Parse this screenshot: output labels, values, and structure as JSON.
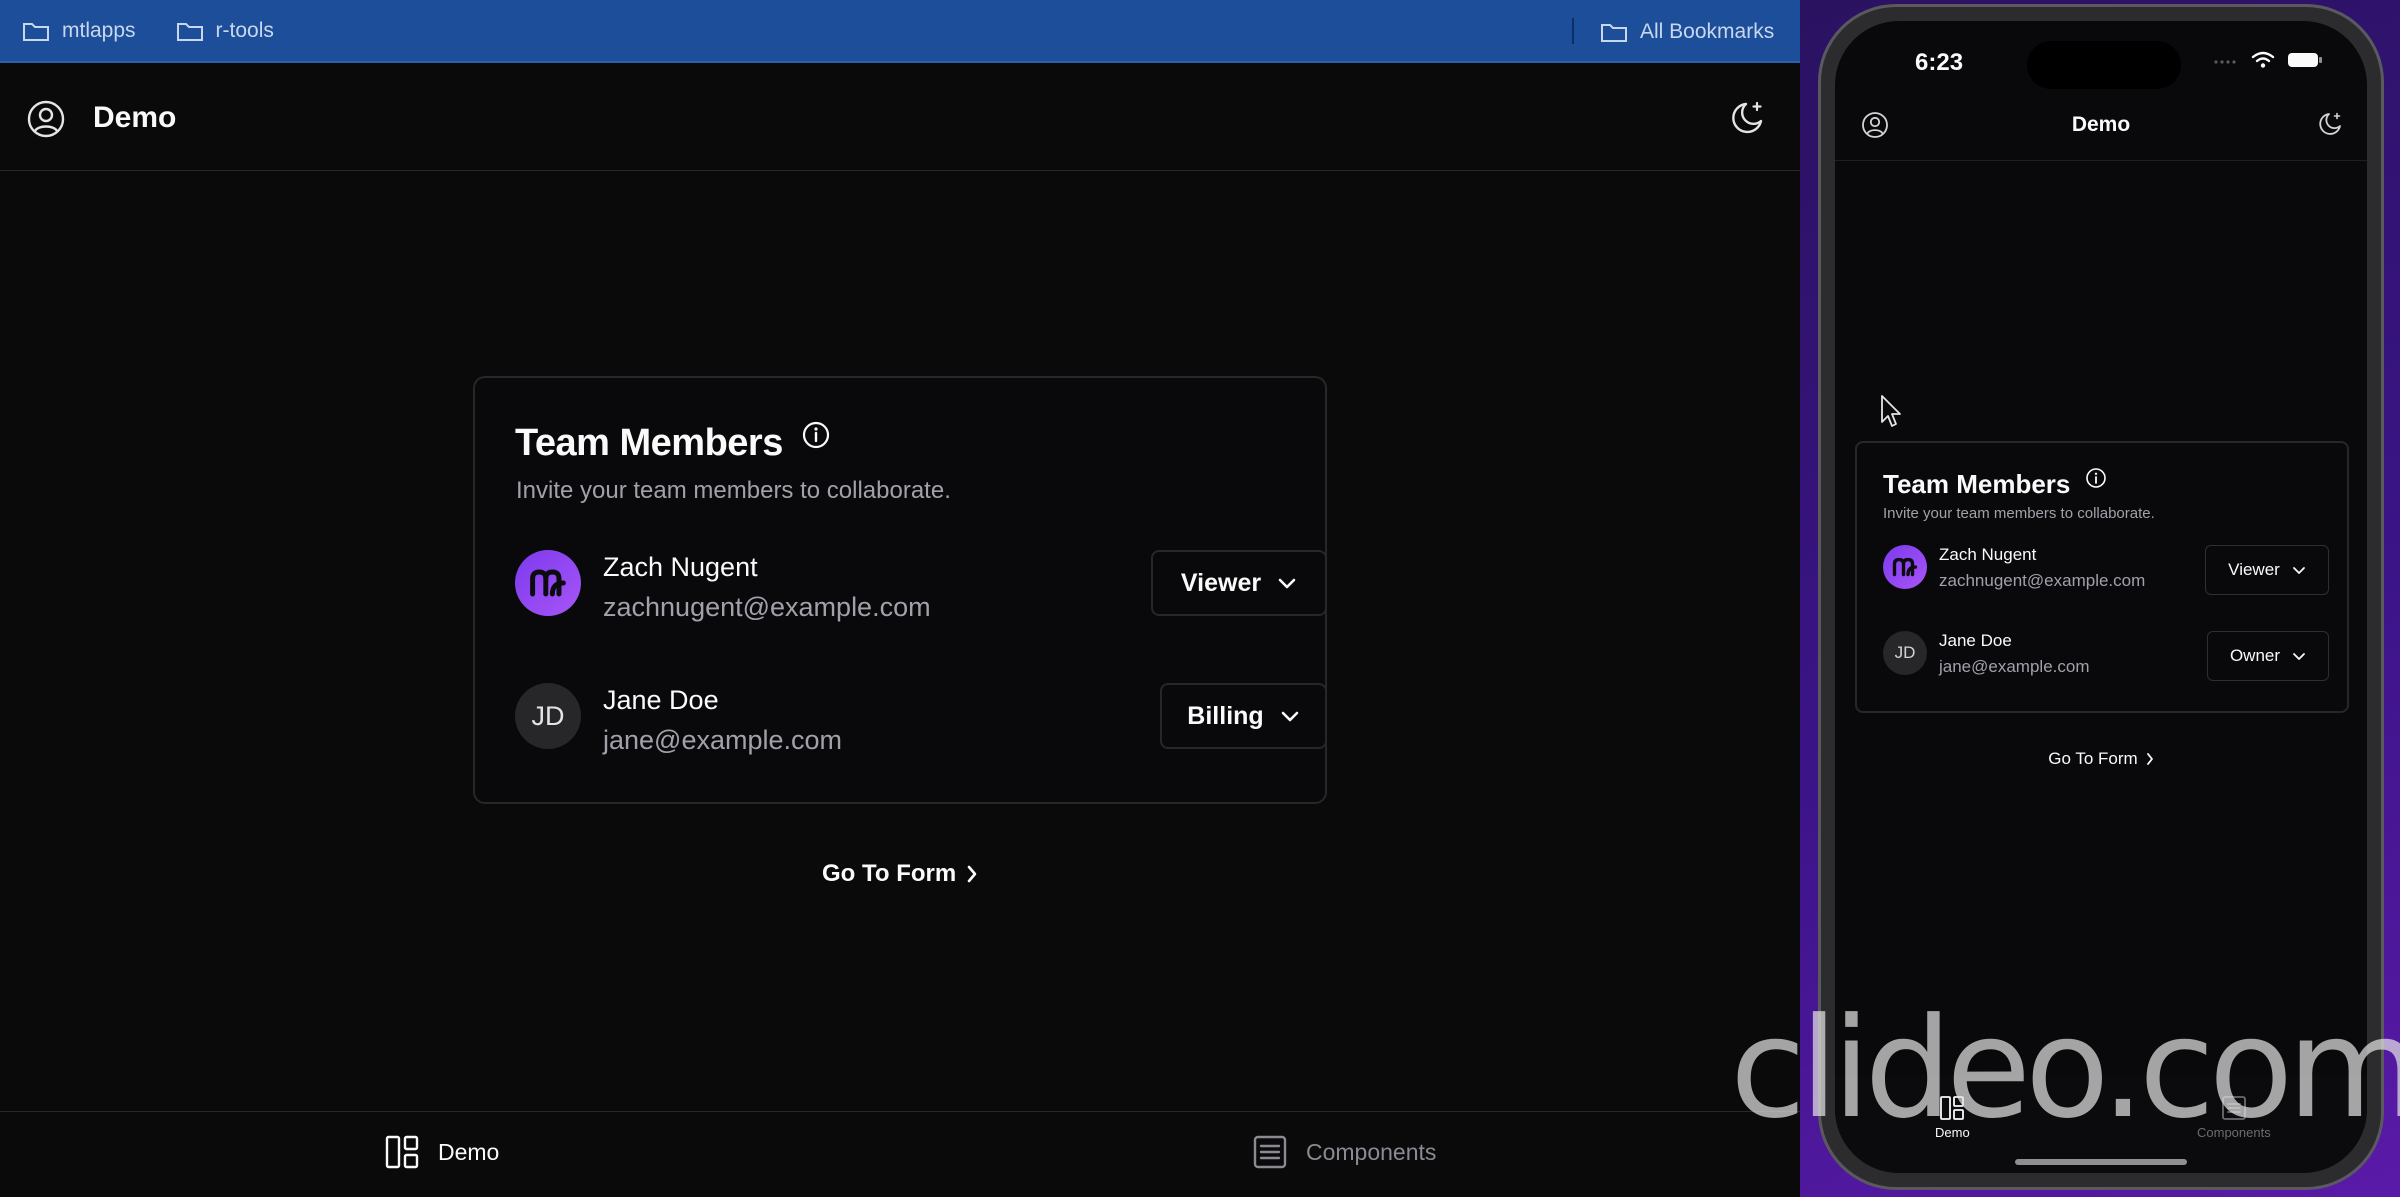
{
  "bookmarks": {
    "items": [
      {
        "label": "mtlapps",
        "icon": "folder-icon"
      },
      {
        "label": "r-tools",
        "icon": "folder-icon"
      }
    ],
    "all_label": "All Bookmarks"
  },
  "app": {
    "title": "Demo",
    "card": {
      "title": "Team Members",
      "description": "Invite your team members to collaborate.",
      "members": [
        {
          "name": "Zach Nugent",
          "email": "zachnugent@example.com",
          "role": "Viewer",
          "avatar": "logo"
        },
        {
          "name": "Jane Doe",
          "email": "jane@example.com",
          "role": "Billing",
          "avatar_initials": "JD"
        }
      ]
    },
    "go_to_form": "Go To Form",
    "tabs": [
      {
        "label": "Demo",
        "active": true
      },
      {
        "label": "Components",
        "active": false
      }
    ]
  },
  "phone": {
    "status_time": "6:23",
    "title": "Demo",
    "card": {
      "title": "Team Members",
      "description": "Invite your team members to collaborate.",
      "members": [
        {
          "name": "Zach Nugent",
          "email": "zachnugent@example.com",
          "role": "Viewer",
          "avatar": "logo"
        },
        {
          "name": "Jane Doe",
          "email": "jane@example.com",
          "role": "Owner",
          "avatar_initials": "JD"
        }
      ]
    },
    "go_to_form": "Go To Form",
    "tabs": [
      {
        "label": "Demo",
        "active": true
      },
      {
        "label": "Components",
        "active": false
      }
    ]
  },
  "watermark": "clideo.com",
  "colors": {
    "bookmarks_bar": "#1c4e9a",
    "background": "#0a0a0b",
    "border": "#27272a",
    "muted_text": "#a1a1aa",
    "avatar_brand": "#8b5cf6",
    "phone_backdrop": "#3b1488"
  }
}
